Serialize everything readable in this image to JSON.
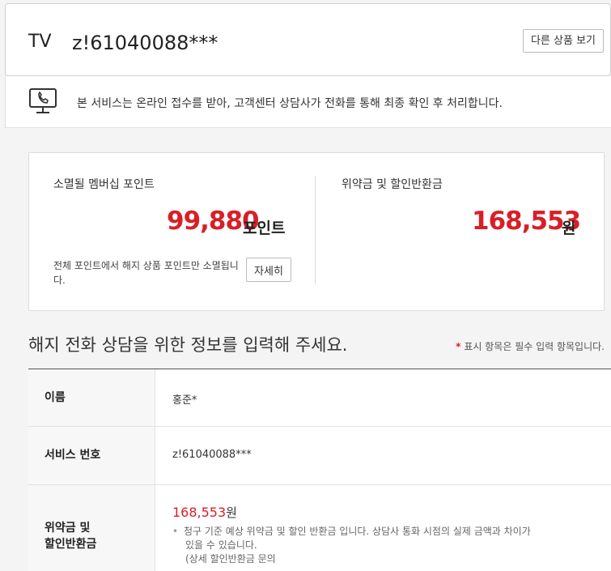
{
  "product": {
    "type": "TV",
    "id": "z!61040088***",
    "other_button": "다른 상품 보기"
  },
  "notice": {
    "icon": "phone-monitor-icon",
    "text": "본 서비스는 온라인 접수를 받아, 고객센터 상담사가 전화를 통해 최종 확인 후 처리합니다."
  },
  "points": {
    "membership": {
      "label": "소멸될 멤버십 포인트",
      "value": "99,880",
      "unit": "포인트",
      "note": "전체 포인트에서 해지 상품 포인트만 소멸됩니다.",
      "detail_button": "자세히"
    },
    "penalty": {
      "label": "위약금 및 할인반환금",
      "value": "168,553",
      "unit": "원"
    }
  },
  "form": {
    "title": "해지 전화 상담을 위한 정보를 입력해 주세요.",
    "required_star": "*",
    "required_note": "표시 항목은 필수 입력 항목입니다.",
    "rows": {
      "name": {
        "label": "이름",
        "value": "홍준*"
      },
      "service_no": {
        "label": "서비스 번호",
        "value": "z!61040088***"
      },
      "fee": {
        "label_line1": "위약금 및",
        "label_line2": "할인반환금",
        "value": "168,553",
        "unit": "원",
        "note_line1": "청구 기준 예상 위약금 및 할인 반환금 입니다. 상담사 통화 시점의 실제 금액과 차이가",
        "note_line2": "있을 수 있습니다.",
        "note_line3": "(상세 할인반환금 문의 "
      }
    }
  },
  "colors": {
    "accent_red": "#d91f26"
  }
}
